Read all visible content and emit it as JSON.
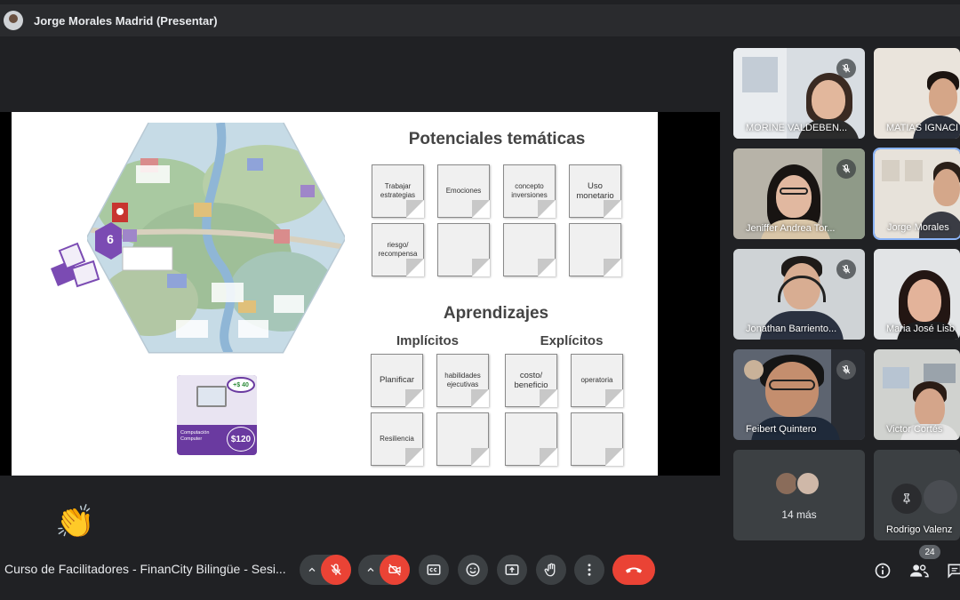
{
  "presenter": {
    "name": "Jorge Morales Madrid (Presentar)"
  },
  "slide": {
    "title_topics": "Potenciales temáticas",
    "topics": [
      "Trabajar estrategias",
      "Emociones",
      "concepto inversiones",
      "Uso monetario",
      "riesgo/ recompensa",
      "",
      "",
      ""
    ],
    "title_learning": "Aprendizajes",
    "implicit_label": "Implícitos",
    "explicit_label": "Explícitos",
    "learning_row1": [
      "Planificar",
      "habilidades ejecutivas",
      "costo/ beneficio",
      "operatoria"
    ],
    "learning_row2": [
      "Resiliencia",
      "",
      "",
      ""
    ],
    "board_number": "6",
    "card": {
      "bonus": "+$ 40",
      "label": "Computación Computer",
      "price": "$120"
    }
  },
  "participants": [
    {
      "name": "MORINE VALDEBEN...",
      "muted": true
    },
    {
      "name": "MATIAS IGNACI",
      "muted": false
    },
    {
      "name": "Jeniffer Andrea Tor...",
      "muted": true
    },
    {
      "name": "Jorge Morales",
      "muted": false
    },
    {
      "name": "Jonathan Barriento...",
      "muted": true
    },
    {
      "name": "Maria José Lisb",
      "muted": false
    },
    {
      "name": "Feibert Quintero",
      "muted": false
    },
    {
      "name": "Victor Cortés",
      "muted": false
    },
    {
      "name": "14 más",
      "muted": false
    },
    {
      "name": "Rodrigo Valenz",
      "muted": false
    }
  ],
  "controls": {
    "meeting_title": "Curso de Facilitadores - FinanCity Bilingüe - Sesi...",
    "reaction": "👏",
    "participant_count": "24",
    "icons": [
      "mic-off-icon",
      "camera-off-icon",
      "captions-icon",
      "emoji-icon",
      "present-icon",
      "raise-hand-icon",
      "more-options-icon",
      "end-call-icon",
      "info-icon",
      "people-icon",
      "chat-icon"
    ]
  },
  "colors": {
    "background": "#202124",
    "danger": "#ea4335",
    "tile": "#3c4043",
    "accent": "#8ab4f8"
  }
}
